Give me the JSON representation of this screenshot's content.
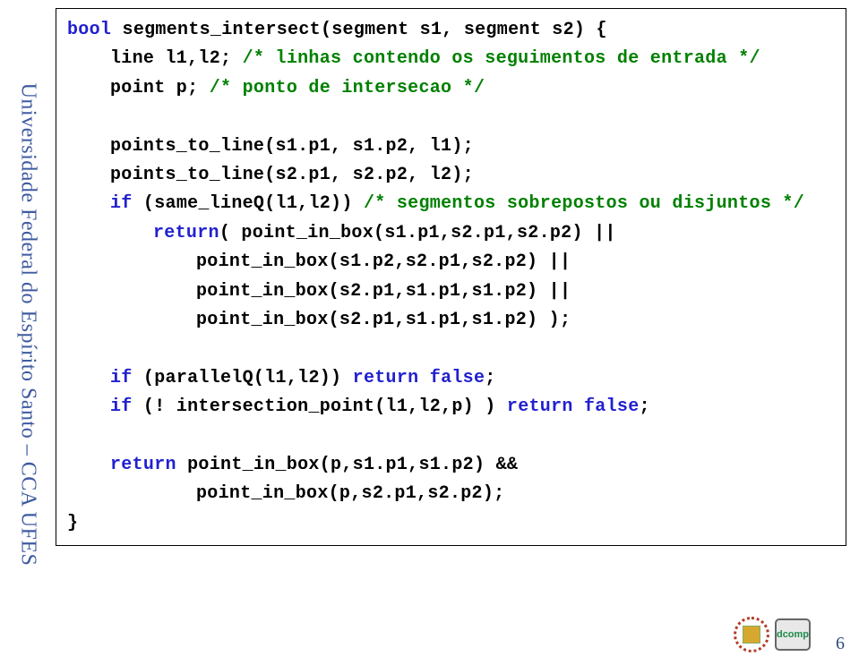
{
  "sidebar_text": "Universidade Federal do Espírito Santo – CCA UFES",
  "page_number": "6",
  "logo2_text": "dcomp",
  "code": {
    "l1a": "bool",
    "l1b": " segments_intersect(segment s1, segment s2) {",
    "l2a": "line l1,l2;    ",
    "l2b": "/* linhas contendo os seguimentos de entrada */",
    "l3a": "point p;       ",
    "l3b": "/* ponto de intersecao */",
    "l4": "points_to_line(s1.p1, s1.p2, l1);",
    "l5": "points_to_line(s2.p1, s2.p2, l2);",
    "l6a": "if",
    "l6b": " (same_lineQ(l1,l2)) ",
    "l6c": "/* segmentos sobrepostos ou disjuntos */",
    "l7a": "return",
    "l7b": "( point_in_box(s1.p1,s2.p1,s2.p2) ||",
    "l8": "point_in_box(s1.p2,s2.p1,s2.p2) ||",
    "l9": "point_in_box(s2.p1,s1.p1,s1.p2) ||",
    "l10": "point_in_box(s2.p1,s1.p1,s1.p2) );",
    "l11a": "if",
    "l11b": " (parallelQ(l1,l2)) ",
    "l11c": "return false",
    "l11d": ";",
    "l12a": "if",
    "l12b": " (! intersection_point(l1,l2,p) ) ",
    "l12c": "return false",
    "l12d": ";",
    "l13a": "return",
    "l13b": "  point_in_box(p,s1.p1,s1.p2) &&",
    "l14": "point_in_box(p,s2.p1,s2.p2);",
    "l15": "}"
  }
}
